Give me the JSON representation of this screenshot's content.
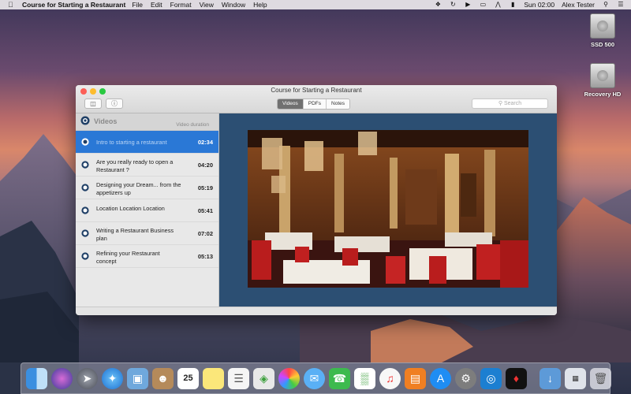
{
  "menubar": {
    "app_name": "Course for Starting a Restaurant",
    "menus": [
      "File",
      "Edit",
      "Format",
      "View",
      "Window",
      "Help"
    ],
    "clock": "Sun 02:00",
    "user": "Alex Tester"
  },
  "desktop": {
    "disks": [
      {
        "label": "SSD 500"
      },
      {
        "label": "Recovery HD"
      }
    ]
  },
  "window": {
    "title": "Course for Starting a Restaurant",
    "tabs": [
      {
        "label": "Videos",
        "active": true
      },
      {
        "label": "PDFs",
        "active": false
      },
      {
        "label": "Notes",
        "active": false
      }
    ],
    "search_placeholder": "Search",
    "sidebar": {
      "title": "Videos",
      "duration_header": "Video duration",
      "items": [
        {
          "title": "Intro to starting a restaurant",
          "duration": "02:34",
          "selected": true
        },
        {
          "title": "Are you really ready to open a Restaurant ?",
          "duration": "04:20",
          "selected": false
        },
        {
          "title": "Designing your Dream... from the appetizers up",
          "duration": "05:19",
          "selected": false
        },
        {
          "title": "Location Location Location",
          "duration": "05:41",
          "selected": false
        },
        {
          "title": "Writing a Restaurant Business plan",
          "duration": "07:02",
          "selected": false
        },
        {
          "title": "Refining your Restaurant concept",
          "duration": "05:13",
          "selected": false
        }
      ]
    }
  },
  "dock": {
    "calendar_day": "25"
  },
  "colors": {
    "selection": "#2a78d6",
    "player_background": "#2c4f73",
    "segment_active": "#707070"
  }
}
